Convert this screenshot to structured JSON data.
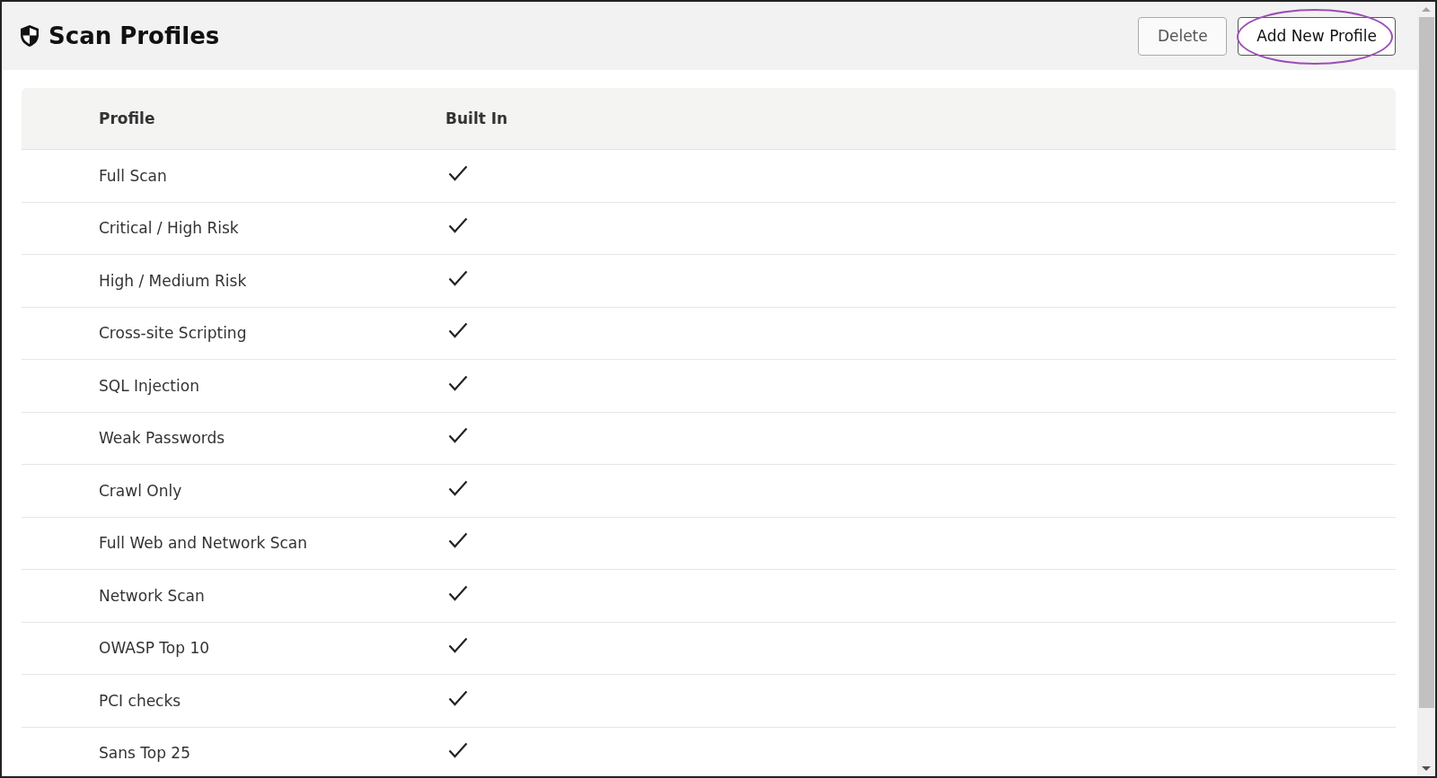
{
  "page": {
    "title": "Scan Profiles"
  },
  "buttons": [
    {
      "label": "Delete",
      "kind": "secondary",
      "highlighted": false
    },
    {
      "label": "Add New Profile",
      "kind": "primary",
      "highlighted": true
    }
  ],
  "table": {
    "columns": [
      "Profile",
      "Built In"
    ],
    "rows": [
      {
        "profile": "Full Scan",
        "built_in": true
      },
      {
        "profile": "Critical / High Risk",
        "built_in": true
      },
      {
        "profile": "High / Medium Risk",
        "built_in": true
      },
      {
        "profile": "Cross-site Scripting",
        "built_in": true
      },
      {
        "profile": "SQL Injection",
        "built_in": true
      },
      {
        "profile": "Weak Passwords",
        "built_in": true
      },
      {
        "profile": "Crawl Only",
        "built_in": true
      },
      {
        "profile": "Full Web and Network Scan",
        "built_in": true
      },
      {
        "profile": "Network Scan",
        "built_in": true
      },
      {
        "profile": "OWASP Top 10",
        "built_in": true
      },
      {
        "profile": "PCI checks",
        "built_in": true
      },
      {
        "profile": "Sans Top 25",
        "built_in": true
      }
    ]
  }
}
